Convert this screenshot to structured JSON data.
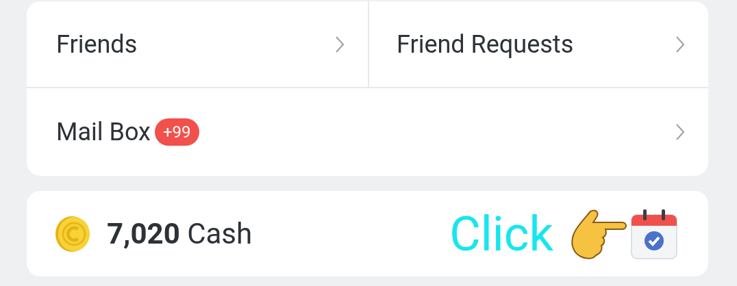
{
  "menu": {
    "rows": [
      {
        "cells": [
          {
            "label": "Friends"
          },
          {
            "label": "Friend Requests"
          }
        ]
      },
      {
        "cells": [
          {
            "label": "Mail Box",
            "badge": "+99"
          }
        ]
      }
    ]
  },
  "wallet": {
    "amount": "7,020",
    "unit": "Cash",
    "hint": "Click"
  }
}
